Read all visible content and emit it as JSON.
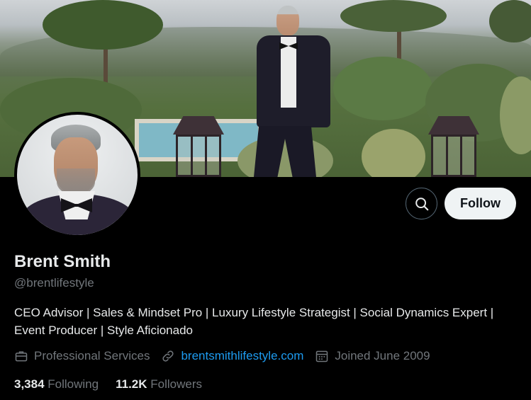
{
  "profile": {
    "name": "Brent Smith",
    "handle": "@brentlifestyle",
    "bio": "CEO Advisor | Sales & Mindset Pro | Luxury Lifestyle Strategist | Social Dynamics Expert | Event Producer | Style Aficionado",
    "category": "Professional Services",
    "website": "brentsmithlifestyle.com",
    "joined": "Joined June 2009"
  },
  "stats": {
    "following_count": "3,384",
    "following_label": "Following",
    "followers_count": "11.2K",
    "followers_label": "Followers"
  },
  "actions": {
    "follow_label": "Follow"
  },
  "icons": {
    "search": "search-icon",
    "briefcase": "briefcase-icon",
    "link": "link-icon",
    "calendar": "calendar-icon"
  },
  "colors": {
    "background": "#000000",
    "primary_text": "#e7e9ea",
    "secondary_text": "#71767b",
    "link": "#1d9bf0",
    "follow_button_bg": "#eff3f4"
  }
}
